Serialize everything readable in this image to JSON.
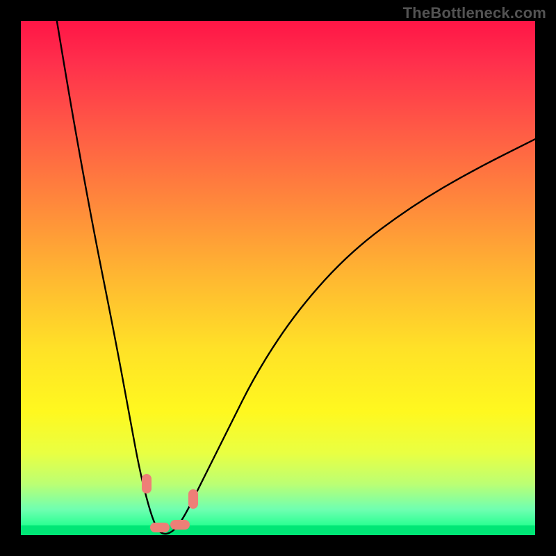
{
  "watermark": "TheBottleneck.com",
  "chart_data": {
    "type": "line",
    "title": "",
    "xlabel": "",
    "ylabel": "",
    "xlim": [
      0,
      100
    ],
    "ylim": [
      0,
      100
    ],
    "grid": false,
    "legend": false,
    "series": [
      {
        "name": "curve",
        "x": [
          7,
          10,
          14,
          18,
          21,
          23,
          25,
          26.5,
          28,
          30,
          32,
          35,
          40,
          46,
          54,
          64,
          76,
          88,
          100
        ],
        "y": [
          100,
          82,
          60,
          40,
          24,
          13,
          5,
          1,
          0,
          1,
          4,
          10,
          20,
          32,
          44,
          55,
          64,
          71,
          77
        ]
      }
    ],
    "markers": [
      {
        "name": "left-descent-marker",
        "x": 24.5,
        "y": 10,
        "shape": "rounded-rect"
      },
      {
        "name": "trough-left-marker",
        "x": 27.0,
        "y": 1.5,
        "shape": "rounded-rect"
      },
      {
        "name": "trough-right-marker",
        "x": 31.0,
        "y": 2.0,
        "shape": "rounded-rect"
      },
      {
        "name": "right-ascent-marker",
        "x": 33.5,
        "y": 7,
        "shape": "rounded-rect"
      }
    ],
    "gradient_stops": [
      {
        "pos": 0.0,
        "color": "#ff1546"
      },
      {
        "pos": 0.08,
        "color": "#ff2f4c"
      },
      {
        "pos": 0.22,
        "color": "#ff5d45"
      },
      {
        "pos": 0.36,
        "color": "#ff8a3b"
      },
      {
        "pos": 0.5,
        "color": "#ffb831"
      },
      {
        "pos": 0.64,
        "color": "#ffe227"
      },
      {
        "pos": 0.76,
        "color": "#fff81f"
      },
      {
        "pos": 0.84,
        "color": "#e9ff42"
      },
      {
        "pos": 0.9,
        "color": "#bcff73"
      },
      {
        "pos": 0.95,
        "color": "#6fffb1"
      },
      {
        "pos": 1.0,
        "color": "#00ff80"
      }
    ]
  }
}
